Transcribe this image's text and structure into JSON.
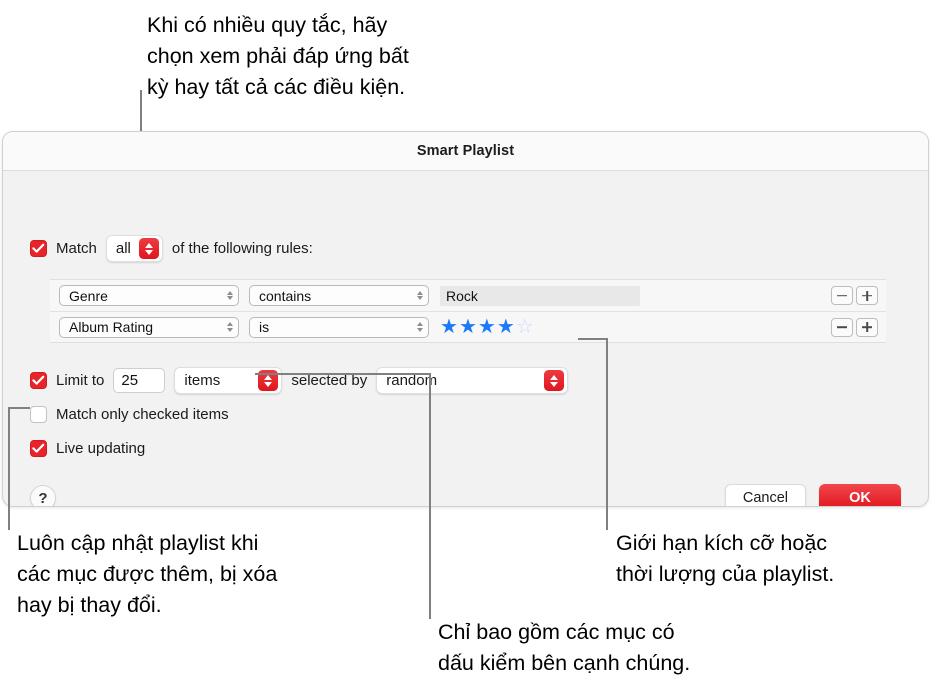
{
  "dialog": {
    "title": "Smart Playlist",
    "match": {
      "checkbox_label": "Match",
      "checked": true,
      "popup_value": "all",
      "suffix_label": "of the following rules:"
    },
    "rules": [
      {
        "field": "Genre",
        "operator": "contains",
        "value": "Rock",
        "value_type": "text",
        "remove_label": "−",
        "add_label": "+"
      },
      {
        "field": "Album Rating",
        "operator": "is",
        "value": "4",
        "value_type": "stars",
        "stars_filled": 4,
        "stars_total": 5,
        "remove_label": "−",
        "add_label": "+"
      }
    ],
    "limit": {
      "checked": true,
      "label": "Limit to",
      "amount": "25",
      "unit": "items",
      "selected_by_label": "selected by",
      "selected_by_value": "random"
    },
    "options": [
      {
        "label": "Match only checked items",
        "checked": false
      },
      {
        "label": "Live updating",
        "checked": true
      }
    ],
    "footer": {
      "help_label": "?",
      "cancel_label": "Cancel",
      "ok_label": "OK"
    }
  },
  "callouts": {
    "top": "Khi có nhiều quy tắc, hãy\nchọn xem phải đáp ứng bất\nkỳ hay tất cả các điều kiện.",
    "bottom_left": "Luôn cập nhật playlist khi\ncác mục được thêm, bị xóa\nhay bị thay đổi.",
    "bottom_center": "Chỉ bao gồm các mục có\ndấu kiểm bên cạnh chúng.",
    "bottom_right": "Giới hạn kích cỡ hoặc\nthời lượng của playlist."
  },
  "colors": {
    "accent_red": "#e8232a",
    "star_blue": "#1a7af8",
    "leader_gray": "#808080"
  }
}
